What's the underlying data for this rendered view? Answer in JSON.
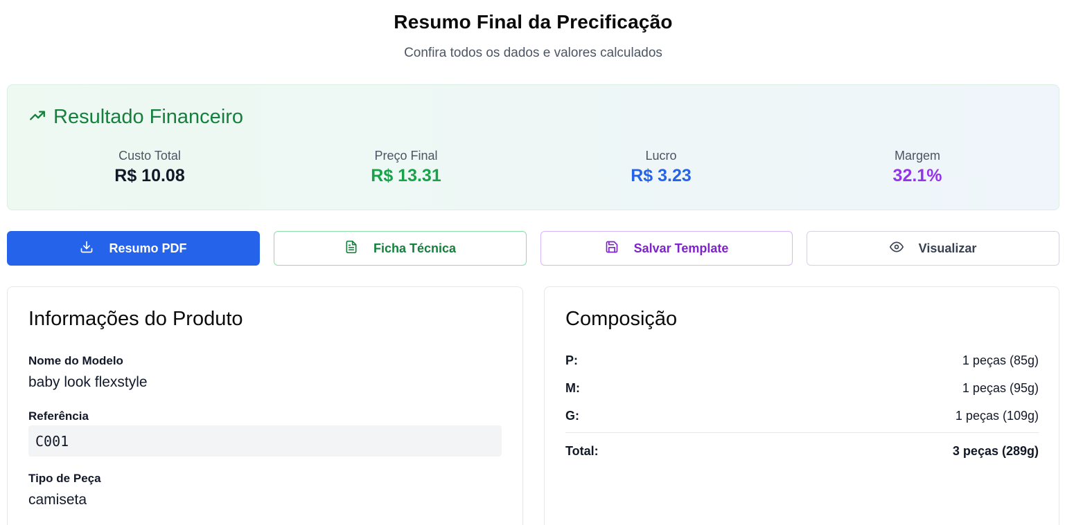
{
  "header": {
    "title": "Resumo Final da Precificação",
    "subtitle": "Confira todos os dados e valores calculados"
  },
  "financial": {
    "title": "Resultado Financeiro",
    "icon": "trending-up-icon",
    "stats": [
      {
        "label": "Custo Total",
        "value": "R$ 10.08",
        "color": "#111827"
      },
      {
        "label": "Preço Final",
        "value": "R$ 13.31",
        "color": "#16a34a"
      },
      {
        "label": "Lucro",
        "value": "R$ 3.23",
        "color": "#2563eb"
      },
      {
        "label": "Margem",
        "value": "32.1%",
        "color": "#9333ea"
      }
    ]
  },
  "actions": {
    "pdf_label": "Resumo PDF",
    "tech_label": "Ficha Técnica",
    "template_label": "Salvar Template",
    "view_label": "Visualizar"
  },
  "product": {
    "title": "Informações do Produto",
    "model_label": "Nome do Modelo",
    "model_value": "baby look flexstyle",
    "ref_label": "Referência",
    "ref_value": "C001",
    "type_label": "Tipo de Peça",
    "type_value": "camiseta"
  },
  "composition": {
    "title": "Composição",
    "rows": [
      {
        "size": "P:",
        "qty": "1 peças (85g)"
      },
      {
        "size": "M:",
        "qty": "1 peças (95g)"
      },
      {
        "size": "G:",
        "qty": "1 peças (109g)"
      }
    ],
    "total_label": "Total:",
    "total_value": "3 peças (289g)"
  },
  "colors": {
    "primary": "#2563eb",
    "green": "#16a34a",
    "purple": "#9333ea"
  }
}
